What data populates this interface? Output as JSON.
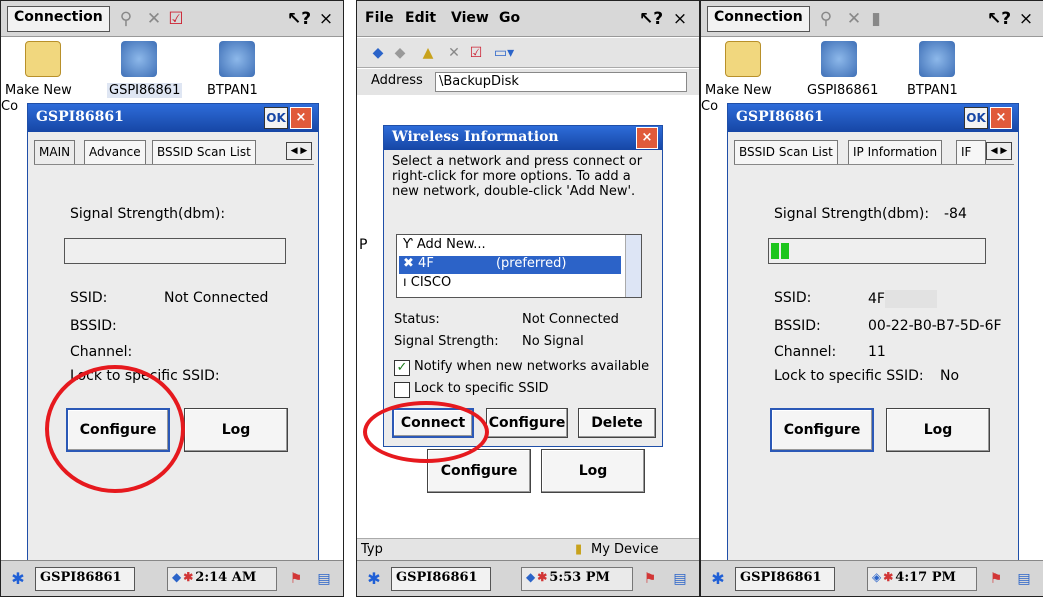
{
  "colors": {
    "accent": "#1646a5",
    "annotation_red": "#e6191e",
    "signal_green": "#1cc51c"
  },
  "screen1": {
    "menu_label": "Connection",
    "icons": {
      "make_new_label": "Make New",
      "make_new_second": "Co",
      "net1_label": "GSPI86861",
      "net2_label": "BTPAN1"
    },
    "dialog": {
      "title": "GSPI86861",
      "ok": "OK",
      "close": "×",
      "tabs": [
        "MAIN",
        "Advance",
        "BSSID Scan List"
      ],
      "signal_label": "Signal Strength(dbm):",
      "ssid_label": "SSID:",
      "ssid_value": "Not Connected",
      "bssid_label": "BSSID:",
      "channel_label": "Channel:",
      "lock_label": "Lock to specific SSID:",
      "configure": "Configure",
      "log": "Log"
    },
    "taskbar": {
      "task": "GSPI86861",
      "time": "2:14 AM"
    }
  },
  "screen2": {
    "menu": {
      "file": "File",
      "edit": "Edit",
      "view": "View",
      "go": "Go"
    },
    "address_label": "Address",
    "address_value": "\\BackupDisk",
    "wireless": {
      "title": "Wireless Information",
      "close": "×",
      "instructions": "Select a network and press connect or right-click for more options.  To add a new network, double-click 'Add New'.",
      "networks": [
        {
          "name": "Add New..."
        },
        {
          "name": "4F",
          "suffix": "(preferred)"
        },
        {
          "name": "CISCO"
        }
      ],
      "status_label": "Status:",
      "status_value": "Not Connected",
      "signal_label": "Signal Strength:",
      "signal_value": "No Signal",
      "notify_label": "Notify when new networks available",
      "notify_checked": true,
      "lock_label": "Lock to specific SSID",
      "lock_checked": false,
      "connect": "Connect",
      "configure": "Configure",
      "delete": "Delete"
    },
    "behind_left_char": "P",
    "behind_configure": "Configure",
    "behind_log": "Log",
    "status_typ": "Typ",
    "status_device": "My Device",
    "taskbar": {
      "task": "GSPI86861",
      "time": "5:53 PM"
    }
  },
  "screen3": {
    "menu_label": "Connection",
    "icons": {
      "make_new_label": "Make New",
      "make_new_second": "Co",
      "net1_label": "GSPI86861",
      "net2_label": "BTPAN1"
    },
    "dialog": {
      "title": "GSPI86861",
      "ok": "OK",
      "close": "×",
      "tabs": [
        "BSSID Scan List",
        "IP Information",
        "IF"
      ],
      "signal_label": "Signal Strength(dbm):",
      "signal_value": "-84",
      "signal_level_fraction": 0.1,
      "ssid_label": "SSID:",
      "ssid_value": "4F",
      "bssid_label": "BSSID:",
      "bssid_value": "00-22-B0-B7-5D-6F",
      "channel_label": "Channel:",
      "channel_value": "11",
      "lock_label": "Lock to specific SSID:",
      "lock_value": "No",
      "configure": "Configure",
      "log": "Log"
    },
    "taskbar": {
      "task": "GSPI86861",
      "time": "4:17 PM"
    }
  }
}
